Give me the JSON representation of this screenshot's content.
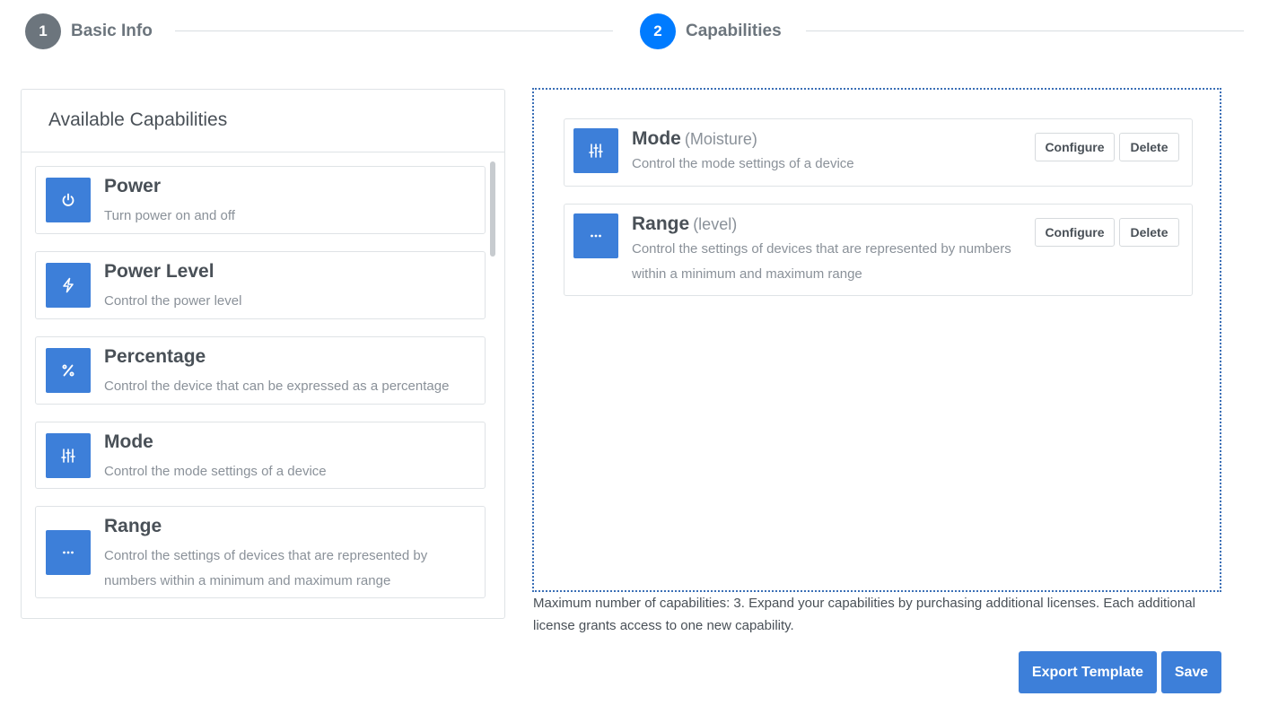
{
  "stepper": {
    "steps": [
      {
        "number": "1",
        "label": "Basic Info",
        "state": "inactive"
      },
      {
        "number": "2",
        "label": "Capabilities",
        "state": "active"
      }
    ]
  },
  "available": {
    "title": "Available Capabilities",
    "items": [
      {
        "name": "Power",
        "description": "Turn power on and off",
        "icon": "power-icon"
      },
      {
        "name": "Power Level",
        "description": "Control the power level",
        "icon": "lightning-icon"
      },
      {
        "name": "Percentage",
        "description": "Control the device that can be expressed as a percentage",
        "icon": "percent-icon"
      },
      {
        "name": "Mode",
        "description": "Control the mode settings of a device",
        "icon": "sliders-icon"
      },
      {
        "name": "Range",
        "description": "Control the settings of devices that are represented by numbers within a minimum and maximum range",
        "icon": "ellipsis-icon"
      }
    ]
  },
  "selected": {
    "items": [
      {
        "name": "Mode",
        "instance": "(Moisture)",
        "description": "Control the mode settings of a device",
        "icon": "sliders-icon"
      },
      {
        "name": "Range",
        "instance": "(level)",
        "description": "Control the settings of devices that are represented by numbers within a minimum and maximum range",
        "icon": "ellipsis-icon"
      }
    ],
    "configure_label": "Configure",
    "delete_label": "Delete"
  },
  "limit_note": "Maximum number of capabilities: 3. Expand your capabilities by purchasing additional licenses. Each additional license grants access to one new capability.",
  "actions": {
    "export_label": "Export Template",
    "save_label": "Save"
  },
  "colors": {
    "accent": "#3d7fd9",
    "step_active": "#007bff",
    "step_inactive": "#6c757d"
  }
}
